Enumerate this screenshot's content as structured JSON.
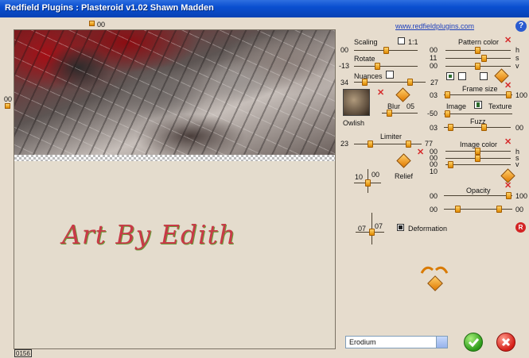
{
  "window": {
    "title": "Redfield Plugins : Plasteroid v1.02   Shawn Madden"
  },
  "link": "www.redfieldplugins.com",
  "preview": {
    "top_marker": "00",
    "left_marker": "00",
    "signature": "Art By Edith",
    "status": "0156"
  },
  "left": {
    "scaling": {
      "label": "Scaling",
      "value": "00",
      "one_to_one_label": "1:1"
    },
    "rotate": {
      "label": "Rotate",
      "value": "-13"
    },
    "nuances": {
      "label": "Nuances",
      "left_value": "34",
      "right_value": "27"
    },
    "thumb": {
      "label": "Owlish"
    },
    "blur": {
      "label": "Blur",
      "value": "05"
    },
    "limiter": {
      "label": "Limiter",
      "left_value": "23",
      "right_value": "77"
    },
    "relief": {
      "label": "Relief",
      "x_value": "10",
      "y_value": "00"
    },
    "deformation": {
      "label": "Deformation",
      "x_value": "07",
      "y_value": "07",
      "checked": true
    }
  },
  "right": {
    "pattern_color": {
      "label": "Pattern color",
      "h": "00",
      "s": "11",
      "v": "00",
      "h_label": "h",
      "s_label": "s",
      "v_label": "v"
    },
    "frame_size": {
      "label": "Frame size",
      "left_value": "03",
      "right_value": "100"
    },
    "image_texture": {
      "left_value": "-50",
      "image_label": "Image",
      "texture_label": "Texture"
    },
    "fuzz": {
      "label": "Fuzz",
      "left_value": "03",
      "right_value": "00"
    },
    "image_color": {
      "label": "Image color",
      "h": "00",
      "s": "00",
      "v": "00",
      "h_label": "h",
      "s_label": "s",
      "v_label": "v",
      "extra": "10"
    },
    "opacity": {
      "label": "Opacity",
      "left_value": "00",
      "right_value": "100",
      "row2_left": "00",
      "row2_right": "00"
    }
  },
  "preset": {
    "selected": "Erodium"
  },
  "buttons": {
    "help": "?",
    "reset": "R"
  }
}
